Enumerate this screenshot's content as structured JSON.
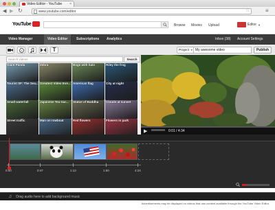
{
  "browser": {
    "tab_title": "Video Editor - YouTube",
    "url": "www.youtube.com/editor"
  },
  "header": {
    "logo_text": "YouTube",
    "browse_label": "Browse",
    "movies_label": "Movies",
    "upload_label": "Upload",
    "user_label": "Editor"
  },
  "tabs": {
    "video_manager": "Video Manager",
    "video_editor": "Video Editor",
    "subscriptions": "Subscriptions",
    "analytics": "Analytics",
    "inbox": "Inbox (38)",
    "account_settings": "Account Settings"
  },
  "toolbar": {
    "project_label": "Project",
    "project_name": "My awesome video",
    "publish_label": "Publish"
  },
  "search": {
    "placeholder": "Search videos",
    "button_label": "Search"
  },
  "videos": [
    {
      "title": "Giant Panda",
      "color": "#7aa0b5"
    },
    {
      "title": "Zebra",
      "color": "#8b8b6b"
    },
    {
      "title": "Bogs with hats",
      "color": "#6e8c5a"
    },
    {
      "title": "Riley the frog",
      "color": "#2b5a7a"
    },
    {
      "title": "Tourist SF: The Sea...",
      "color": "#4f6f8f"
    },
    {
      "title": "Greatest Video Eve...",
      "color": "#5d8f3a"
    },
    {
      "title": "American flag",
      "color": "#3f6fb5"
    },
    {
      "title": "City at night",
      "color": "#253050"
    },
    {
      "title": "Small waterfall",
      "color": "#4b6a3b"
    },
    {
      "title": "Japanese Tea Gar...",
      "color": "#6b8a45"
    },
    {
      "title": "Statue of Buddha",
      "color": "#6b6b55"
    },
    {
      "title": "Clouds at sunset",
      "color": "#8a7a9a"
    },
    {
      "title": "Street traffic",
      "color": "#3a3a3a"
    },
    {
      "title": "Man on rowboat",
      "color": "#4a6a8a"
    },
    {
      "title": "Red flowers",
      "color": "#9a3030"
    },
    {
      "title": "Flowers in park",
      "color": "#a03545"
    }
  ],
  "player": {
    "time": "0:01 / 4:34",
    "progress": 0.0036
  },
  "timeline": {
    "markers": [
      "0:00",
      "0:47",
      "1:13",
      "1:50",
      "4:24"
    ]
  },
  "audio_hint": "Drag audio here to add background music",
  "footer_text": "Advertisements may be displayed on videos that use content available through the YouTube Video Editor."
}
